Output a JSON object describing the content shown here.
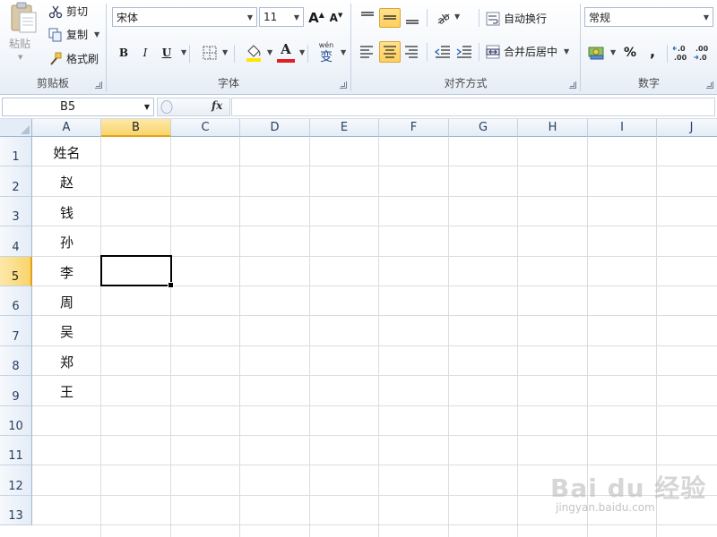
{
  "ribbon": {
    "clipboard": {
      "label": "剪贴板",
      "paste": "粘贴",
      "cut": "剪切",
      "copy": "复制",
      "format_painter": "格式刷"
    },
    "font": {
      "label": "字体",
      "font_name": "宋体",
      "font_size": "11",
      "grow": "A",
      "shrink": "A",
      "bold": "B",
      "italic": "I",
      "underline": "U",
      "font_color_glyph": "A",
      "phonetic": "wén",
      "phonetic_char": "变",
      "font_color": "#e02020",
      "fill_color": "#ffe600"
    },
    "alignment": {
      "label": "对齐方式",
      "wrap_text": "自动换行",
      "merge_center": "合并后居中"
    },
    "number": {
      "label": "数字",
      "format": "常规",
      "percent": "%",
      "comma": ",",
      "inc_decimal": "←.0\n.00",
      "dec_decimal": ".00\n→.0"
    }
  },
  "formula_bar": {
    "name_box": "B5",
    "fx": "fx",
    "formula": ""
  },
  "sheet": {
    "columns": [
      "A",
      "B",
      "C",
      "D",
      "E",
      "F",
      "G",
      "H",
      "I",
      "J"
    ],
    "rows": [
      "1",
      "2",
      "3",
      "4",
      "5",
      "6",
      "7",
      "8",
      "9",
      "10",
      "11",
      "12",
      "13"
    ],
    "selected_column": "B",
    "selected_row": "5",
    "column_a": [
      "姓名",
      "赵",
      "钱",
      "孙",
      "李",
      "周",
      "吴",
      "郑",
      "王"
    ]
  },
  "watermark": {
    "logo": "Bai du 经验",
    "url": "jingyan.baidu.com"
  }
}
